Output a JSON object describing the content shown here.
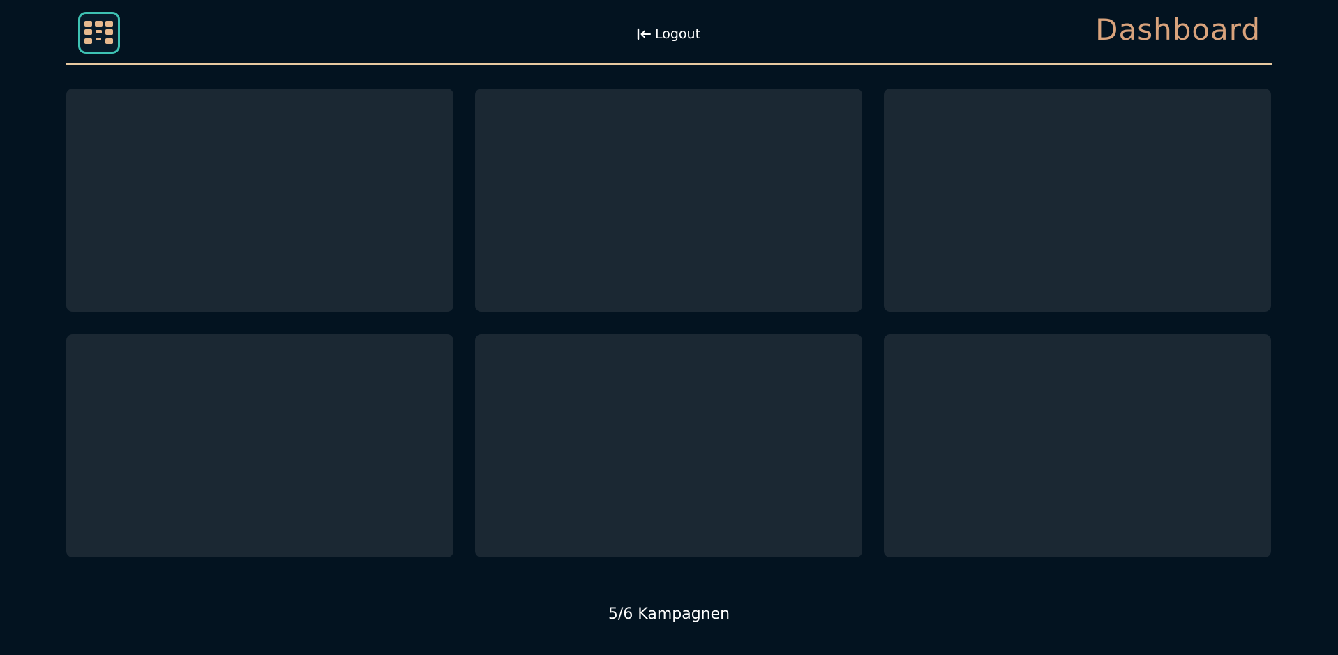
{
  "header": {
    "app_icon": "dashboard-grid-icon",
    "logout_icon": "logout-arrow-icon",
    "logout_label": "Logout",
    "title": "Dashboard"
  },
  "campaigns": {
    "cards": [
      {
        "id": 1,
        "state": "empty"
      },
      {
        "id": 2,
        "state": "empty"
      },
      {
        "id": 3,
        "state": "empty"
      },
      {
        "id": 4,
        "state": "empty"
      },
      {
        "id": 5,
        "state": "empty"
      },
      {
        "id": 6,
        "state": "empty"
      }
    ]
  },
  "footer": {
    "count_label": "5/6 Kampagnen"
  },
  "colors": {
    "background": "#031320",
    "card": "#1b2833",
    "accent_line": "#e8c9a0",
    "title": "#d9a37c",
    "icon_border": "#3ec2b3",
    "icon_fill": "#e7b98e"
  }
}
